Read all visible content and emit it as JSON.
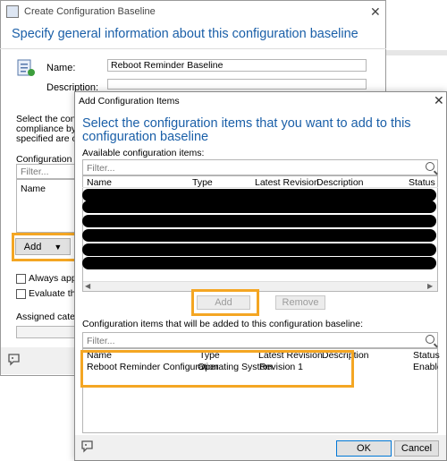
{
  "bg_window": {
    "title": "Create Configuration Baseline",
    "heading": "Specify general information about this configuration baseline",
    "name_label": "Name:",
    "name_value": "Reboot Reminder Baseline",
    "description_label": "Description:",
    "select_text_1": "Select the configu",
    "select_text_2": "compliance by this",
    "select_text_3": "specified are compl",
    "config_data_label": "Configuration data:",
    "filter_placeholder": "Filter...",
    "name_col": "Name",
    "add_button": "Add",
    "always_apply": "Always apply thi",
    "evaluate": "Evaluate this ba",
    "assigned_categories": "Assigned categorie"
  },
  "dialog": {
    "title": "Add Configuration Items",
    "close": "X",
    "heading": "Select the configuration items that you want to add to this configuration baseline",
    "available_label": "Available configuration items:",
    "filter_placeholder": "Filter...",
    "columns": [
      "Name",
      "Type",
      "Latest Revision",
      "Description",
      "Status"
    ],
    "add_button": "Add",
    "remove_button": "Remove",
    "added_label": "Configuration items that will be added to this configuration baseline:",
    "added_columns": [
      "Name",
      "Type",
      "Latest Revision",
      "Description",
      "Status"
    ],
    "added_rows": [
      {
        "name": "Reboot Reminder Configuration",
        "type": "Operating System",
        "revision": "Revision 1",
        "description": "",
        "status": "Enable"
      }
    ],
    "ok_button": "OK",
    "cancel_button": "Cancel"
  },
  "colors": {
    "heading": "#1a5fa8",
    "highlight": "#f4a623"
  }
}
